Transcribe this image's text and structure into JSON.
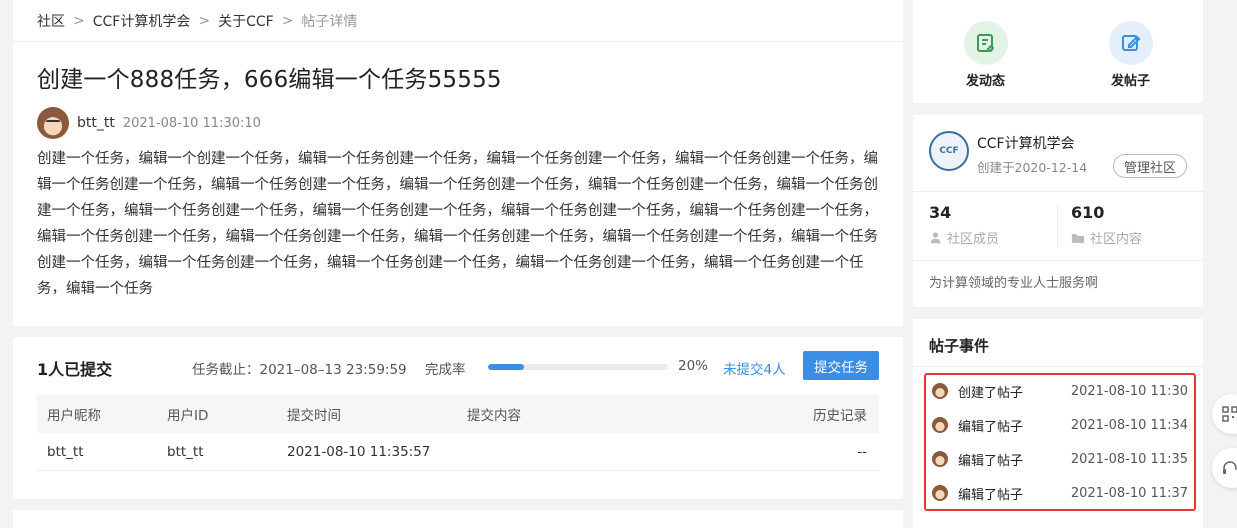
{
  "breadcrumb": {
    "items": [
      "社区",
      "CCF计算机学会",
      "关于CCF"
    ],
    "current": "帖子详情",
    "separator": ">"
  },
  "post": {
    "title": "创建一个888任务，666编辑一个任务55555",
    "author": "btt_tt",
    "time": "2021-08-10 11:30:10",
    "body": "创建一个任务，编辑一个创建一个任务，编辑一个任务创建一个任务，编辑一个任务创建一个任务，编辑一个任务创建一个任务，编辑一个任务创建一个任务，编辑一个任务创建一个任务，编辑一个任务创建一个任务，编辑一个任务创建一个任务，编辑一个任务创建一个任务，编辑一个任务创建一个任务，编辑一个任务创建一个任务，编辑一个任务创建一个任务，编辑一个任务创建一个任务，编辑一个任务创建一个任务，编辑一个任务创建一个任务，编辑一个任务创建一个任务，编辑一个任务创建一个任务，编辑一个任务创建一个任务，编辑一个任务创建一个任务，编辑一个任务创建一个任务，编辑一个任务创建一个任务，编辑一个任务创建一个任务，编辑一个任务"
  },
  "task": {
    "submitted_title": "1人已提交",
    "deadline": "任务截止：2021–08–13 23:59:59",
    "rate_label": "完成率",
    "progress_fraction": 0.2,
    "percent": "20%",
    "unsubmitted": "未提交4人",
    "submit_button": "提交任务",
    "columns": [
      "用户昵称",
      "用户ID",
      "提交时间",
      "提交内容",
      "历史记录"
    ],
    "rows": [
      [
        "btt_tt",
        "btt_tt",
        "2021-08-10 11:35:57",
        "",
        "--"
      ]
    ]
  },
  "actions": {
    "post_dynamic": "发动态",
    "post_thread": "发帖子",
    "accent_green": "#e3f3e6",
    "accent_blue": "#e4effb"
  },
  "community": {
    "logo_text": "CCF",
    "name": "CCF计算机学会",
    "created": "创建于2020-12-14",
    "manage_button": "管理社区",
    "members_count": "34",
    "members_label": "社区成员",
    "content_count": "610",
    "content_label": "社区内容",
    "description": "为计算领域的专业人士服务啊"
  },
  "events": {
    "title": "帖子事件",
    "highlight_color": "#e53935",
    "items": [
      {
        "text": "创建了帖子",
        "time": "2021-08-10 11:30"
      },
      {
        "text": "编辑了帖子",
        "time": "2021-08-10 11:34"
      },
      {
        "text": "编辑了帖子",
        "time": "2021-08-10 11:35"
      },
      {
        "text": "编辑了帖子",
        "time": "2021-08-10 11:37"
      }
    ]
  }
}
